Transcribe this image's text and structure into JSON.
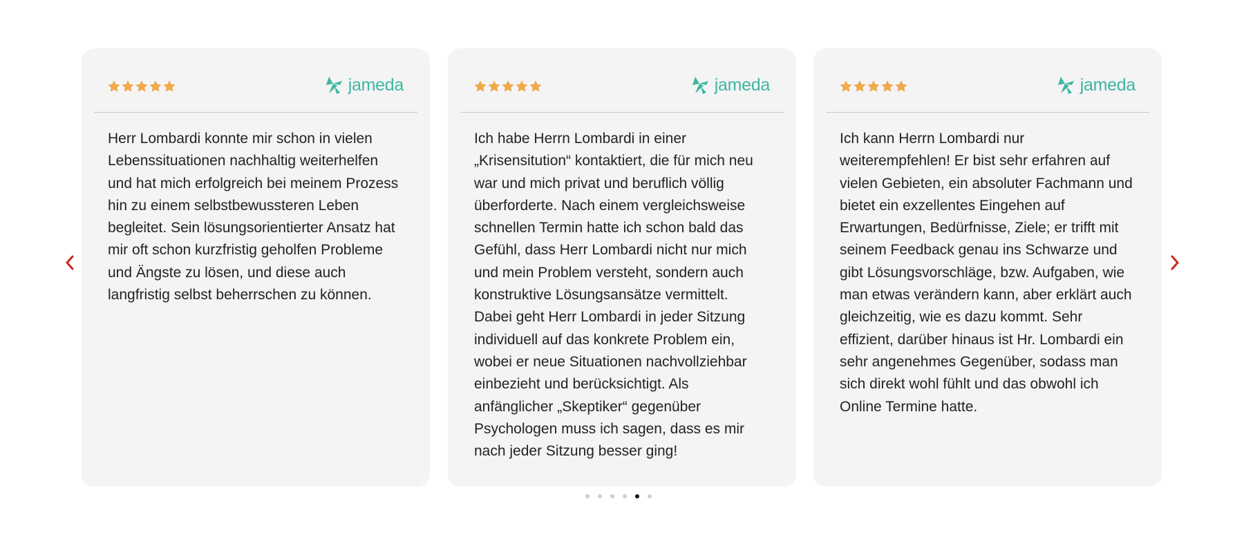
{
  "colors": {
    "star": "#f0a94b",
    "brand": "#3fb6a1",
    "nav_arrow": "#c8281e",
    "card_bg": "#f4f4f4",
    "divider": "#d7c2b4",
    "dot_active": "#111111",
    "dot_inactive": "#cfcfcf"
  },
  "reviews": [
    {
      "rating": 5,
      "source": "jameda",
      "text": "Herr Lombardi konnte mir schon in vielen Lebenssituationen nachhaltig weiterhelfen und hat mich erfolgreich bei meinem Prozess hin zu einem selbstbewussteren Leben begleitet. Sein lösungsorientierter Ansatz hat mir oft schon kurzfristig geholfen Probleme und Ängste zu lösen, und diese auch langfristig selbst beherrschen zu können."
    },
    {
      "rating": 5,
      "source": "jameda",
      "text": "Ich habe Herrn Lombardi in einer „Krisensitution“ kontaktiert, die für mich neu war und mich privat und beruflich völlig überforderte. Nach einem vergleichsweise schnellen Termin hatte ich schon bald das Gefühl, dass Herr Lombardi nicht nur mich und mein Problem versteht, sondern auch konstruktive Lösungsansätze vermittelt. Dabei geht Herr Lombardi in jeder Sitzung individuell auf das konkrete Problem ein, wobei er neue Situationen nachvollziehbar einbezieht und berücksichtigt. Als anfänglicher „Skeptiker“ gegenüber Psychologen muss ich sagen, dass es mir nach jeder Sitzung besser ging!"
    },
    {
      "rating": 5,
      "source": "jameda",
      "text": "Ich kann Herrn Lombardi nur weiterempfehlen! Er bist sehr erfahren auf vielen Gebieten, ein absoluter Fachmann und bietet ein exzellentes Eingehen auf Erwartungen, Bedürfnisse, Ziele; er trifft mit seinem Feedback genau ins Schwarze und gibt Lösungsvorschläge, bzw. Aufgaben, wie man etwas verändern kann, aber erklärt auch gleichzeitig, wie es dazu kommt. Sehr effizient, darüber hinaus ist Hr. Lombardi ein sehr angenehmes Gegenüber, sodass man sich direkt wohl fühlt und das obwohl ich Online Termine hatte."
    }
  ],
  "navigation": {
    "prev_icon": "chevron-left-icon",
    "next_icon": "chevron-right-icon"
  },
  "pagination": {
    "total": 6,
    "active_index": 4
  }
}
